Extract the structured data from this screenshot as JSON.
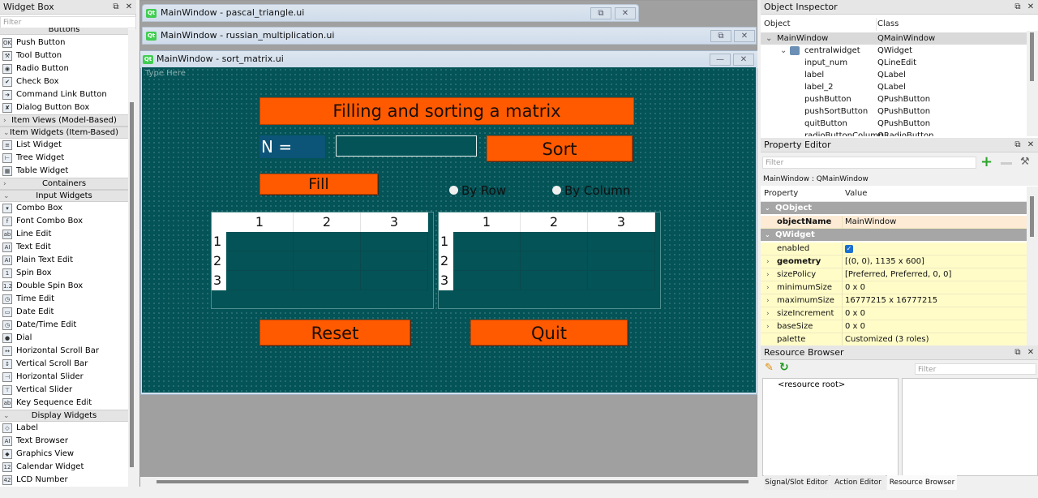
{
  "widget_box": {
    "title": "Widget Box",
    "filter_placeholder": "Filter",
    "float_icon": "float-icon",
    "close_icon": "close-icon",
    "partial_category": "Buttons",
    "sections": [
      {
        "type": "item",
        "label": "Push Button",
        "icon": "OK"
      },
      {
        "type": "item",
        "label": "Tool Button",
        "icon": "⚒"
      },
      {
        "type": "item",
        "label": "Radio Button",
        "icon": "◉"
      },
      {
        "type": "item",
        "label": "Check Box",
        "icon": "✔"
      },
      {
        "type": "item",
        "label": "Command Link Button",
        "icon": "➔"
      },
      {
        "type": "item",
        "label": "Dialog Button Box",
        "icon": "✘"
      },
      {
        "type": "cat",
        "label": "Item Views (Model-Based)",
        "expanded": false
      },
      {
        "type": "cat",
        "label": "Item Widgets (Item-Based)",
        "expanded": true
      },
      {
        "type": "item",
        "label": "List Widget",
        "icon": "≡"
      },
      {
        "type": "item",
        "label": "Tree Widget",
        "icon": "⊢"
      },
      {
        "type": "item",
        "label": "Table Widget",
        "icon": "▦"
      },
      {
        "type": "cat",
        "label": "Containers",
        "expanded": false
      },
      {
        "type": "cat",
        "label": "Input Widgets",
        "expanded": true
      },
      {
        "type": "item",
        "label": "Combo Box",
        "icon": "▾"
      },
      {
        "type": "item",
        "label": "Font Combo Box",
        "icon": "f"
      },
      {
        "type": "item",
        "label": "Line Edit",
        "icon": "ab"
      },
      {
        "type": "item",
        "label": "Text Edit",
        "icon": "AI"
      },
      {
        "type": "item",
        "label": "Plain Text Edit",
        "icon": "AI"
      },
      {
        "type": "item",
        "label": "Spin Box",
        "icon": "1"
      },
      {
        "type": "item",
        "label": "Double Spin Box",
        "icon": "1.2"
      },
      {
        "type": "item",
        "label": "Time Edit",
        "icon": "◷"
      },
      {
        "type": "item",
        "label": "Date Edit",
        "icon": "▭"
      },
      {
        "type": "item",
        "label": "Date/Time Edit",
        "icon": "◷"
      },
      {
        "type": "item",
        "label": "Dial",
        "icon": "●"
      },
      {
        "type": "item",
        "label": "Horizontal Scroll Bar",
        "icon": "↔"
      },
      {
        "type": "item",
        "label": "Vertical Scroll Bar",
        "icon": "↕"
      },
      {
        "type": "item",
        "label": "Horizontal Slider",
        "icon": "⊣"
      },
      {
        "type": "item",
        "label": "Vertical Slider",
        "icon": "⊤"
      },
      {
        "type": "item",
        "label": "Key Sequence Edit",
        "icon": "ab"
      },
      {
        "type": "cat",
        "label": "Display Widgets",
        "expanded": true
      },
      {
        "type": "item",
        "label": "Label",
        "icon": "◇"
      },
      {
        "type": "item",
        "label": "Text Browser",
        "icon": "AI"
      },
      {
        "type": "item",
        "label": "Graphics View",
        "icon": "◆"
      },
      {
        "type": "item",
        "label": "Calendar Widget",
        "icon": "12"
      },
      {
        "type": "item",
        "label": "LCD Number",
        "icon": "42"
      }
    ]
  },
  "mdi": {
    "windows": [
      {
        "title": "MainWindow - pascal_triangle.ui",
        "logo": "Qt"
      },
      {
        "title": "MainWindow - russian_multiplication.ui",
        "logo": "Qt"
      },
      {
        "title": "MainWindow - sort_matrix.ui",
        "logo": "Qt"
      }
    ],
    "restore_glyph": "⧉",
    "close_glyph": "✕",
    "minimize_glyph": "—"
  },
  "form": {
    "menu_placeholder": "Type Here",
    "title": "Filling and sorting a matrix",
    "n_label": "N =",
    "input_value": "",
    "sort_button": "Sort",
    "fill_button": "Fill",
    "radio_row": "By Row",
    "radio_column": "By Column",
    "reset_button": "Reset",
    "quit_button": "Quit",
    "colors": {
      "background": "#035357",
      "button": "#ff5a00",
      "label_bg": "#0c5478"
    },
    "tables": [
      {
        "col_headers": [
          "1",
          "2",
          "3"
        ],
        "row_headers": [
          "1",
          "2",
          "3"
        ],
        "cells": [
          [
            "",
            "",
            ""
          ],
          [
            "",
            "",
            ""
          ],
          [
            "",
            "",
            ""
          ]
        ]
      },
      {
        "col_headers": [
          "1",
          "2",
          "3"
        ],
        "row_headers": [
          "1",
          "2",
          "3"
        ],
        "cells": [
          [
            "",
            "",
            ""
          ],
          [
            "",
            "",
            ""
          ],
          [
            "",
            "",
            ""
          ]
        ]
      }
    ]
  },
  "object_inspector": {
    "title": "Object Inspector",
    "col_object": "Object",
    "col_class": "Class",
    "rows": [
      {
        "object": "MainWindow",
        "class": "QMainWindow",
        "level": 0,
        "expanded": true,
        "selected": true
      },
      {
        "object": "centralwidget",
        "class": "QWidget",
        "level": 1,
        "expanded": true
      },
      {
        "object": "input_num",
        "class": "QLineEdit",
        "level": 2
      },
      {
        "object": "label",
        "class": "QLabel",
        "level": 2
      },
      {
        "object": "label_2",
        "class": "QLabel",
        "level": 2
      },
      {
        "object": "pushButton",
        "class": "QPushButton",
        "level": 2
      },
      {
        "object": "pushSortButton",
        "class": "QPushButton",
        "level": 2
      },
      {
        "object": "quitButton",
        "class": "QPushButton",
        "level": 2
      },
      {
        "object": "radioButtonColumn",
        "class": "QRadioButton",
        "level": 2
      }
    ]
  },
  "property_editor": {
    "title": "Property Editor",
    "filter_placeholder": "Filter",
    "context": "MainWindow : QMainWindow",
    "col_property": "Property",
    "col_value": "Value",
    "groups": [
      {
        "name": "QObject",
        "props": [
          {
            "name": "objectName",
            "value": "MainWindow",
            "bold": true,
            "expandable": false
          }
        ]
      },
      {
        "name": "QWidget",
        "props": [
          {
            "name": "enabled",
            "value": "",
            "checkbox": true,
            "checked": true,
            "expandable": false
          },
          {
            "name": "geometry",
            "value": "[(0, 0), 1135 x 600]",
            "bold": true,
            "expandable": true
          },
          {
            "name": "sizePolicy",
            "value": "[Preferred, Preferred, 0, 0]",
            "expandable": true
          },
          {
            "name": "minimumSize",
            "value": "0 x 0",
            "expandable": true
          },
          {
            "name": "maximumSize",
            "value": "16777215 x 16777215",
            "expandable": true
          },
          {
            "name": "sizeIncrement",
            "value": "0 x 0",
            "expandable": true
          },
          {
            "name": "baseSize",
            "value": "0 x 0",
            "expandable": true
          },
          {
            "name": "palette",
            "value": "Customized (3 roles)",
            "expandable": false
          }
        ]
      }
    ]
  },
  "resource_browser": {
    "title": "Resource Browser",
    "filter_placeholder": "Filter",
    "root": "<resource root>"
  },
  "bottom_tabs": [
    {
      "label": "Signal/Slot Editor",
      "active": false
    },
    {
      "label": "Action Editor",
      "active": false
    },
    {
      "label": "Resource Browser",
      "active": true
    }
  ]
}
